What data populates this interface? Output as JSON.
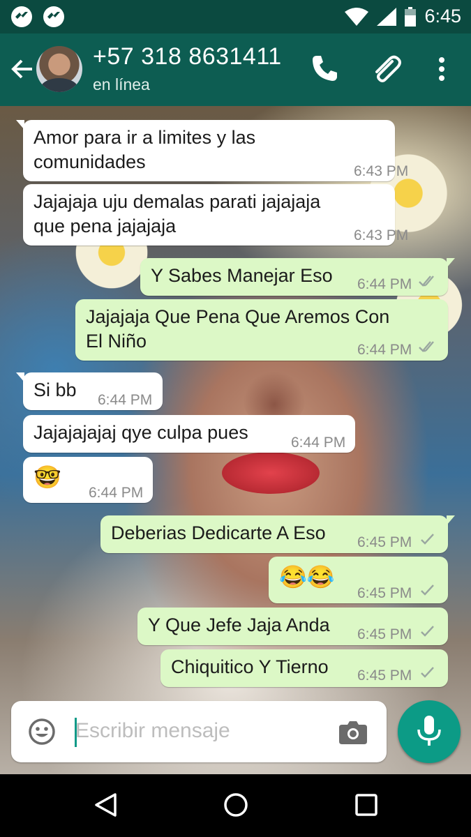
{
  "status_bar": {
    "time": "6:45",
    "left_icons": [
      "messenger-icon",
      "messenger-icon"
    ],
    "right_icons": [
      "wifi-icon",
      "signal-icon",
      "battery-icon"
    ]
  },
  "header": {
    "contact_name": "+57 318 8631411",
    "status": "en línea",
    "icons": [
      "back-arrow-icon",
      "phone-icon",
      "paperclip-icon",
      "more-vert-icon"
    ]
  },
  "messages": [
    {
      "dir": "in",
      "text": "Amor para ir a limites y las\ncomunidades",
      "time": "6:43 PM"
    },
    {
      "dir": "in",
      "text": "Jajajaja uju demalas parati jajajaja\nque pena jajajaja",
      "time": "6:43 PM"
    },
    {
      "dir": "out",
      "text": "Y Sabes Manejar Eso",
      "time": "6:44 PM",
      "ticks": "double"
    },
    {
      "dir": "out",
      "text": "Jajajaja Que Pena Que Aremos Con\nEl Niño",
      "time": "6:44 PM",
      "ticks": "double"
    },
    {
      "dir": "in",
      "text": "Si bb",
      "time": "6:44 PM"
    },
    {
      "dir": "in",
      "text": "Jajajajajaj qye culpa pues",
      "time": "6:44 PM"
    },
    {
      "dir": "in",
      "text": "🤓",
      "time": "6:44 PM"
    },
    {
      "dir": "out",
      "text": "Deberias Dedicarte A Eso",
      "time": "6:45 PM",
      "ticks": "single"
    },
    {
      "dir": "out",
      "text": "😂😂",
      "time": "6:45 PM",
      "ticks": "single"
    },
    {
      "dir": "out",
      "text": "Y Que Jefe Jaja Anda",
      "time": "6:45 PM",
      "ticks": "single"
    },
    {
      "dir": "out",
      "text": "Chiquitico Y Tierno",
      "time": "6:45 PM",
      "ticks": "single"
    }
  ],
  "composer": {
    "placeholder": "Escribir mensaje",
    "icons": [
      "emoji-icon",
      "camera-icon",
      "microphone-icon"
    ]
  },
  "nav_bar": {
    "icons": [
      "back-triangle-icon",
      "home-circle-icon",
      "recents-square-icon"
    ]
  },
  "colors": {
    "status_bar": "#0b4a40",
    "app_bar": "#0d5d52",
    "incoming_bubble": "#ffffff",
    "outgoing_bubble": "#dcf8c6",
    "accent": "#0c9b86",
    "read_ticks": "#9aa7a0"
  }
}
